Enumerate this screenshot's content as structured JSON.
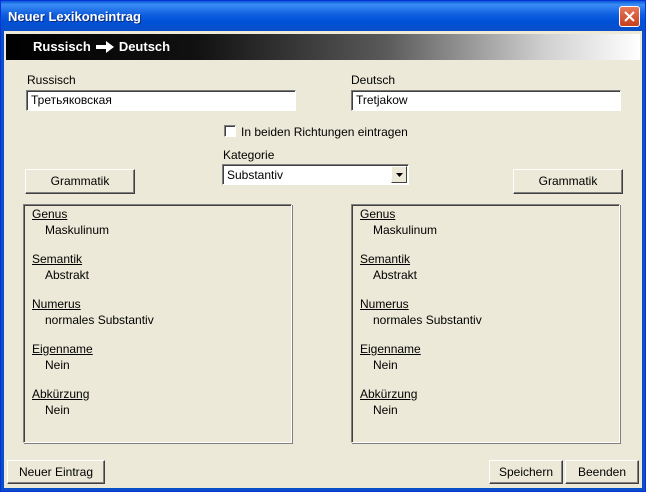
{
  "window": {
    "title": "Neuer Lexikoneintrag"
  },
  "banner": {
    "source": "Russisch",
    "target": "Deutsch"
  },
  "left": {
    "label": "Russisch",
    "value": "Третьяковская"
  },
  "right": {
    "label": "Deutsch",
    "value": "Tretjakow"
  },
  "options": {
    "both_directions_label": "In beiden Richtungen eintragen",
    "both_directions_checked": false
  },
  "category": {
    "label": "Kategorie",
    "selected": "Substantiv"
  },
  "buttons": {
    "grammar_left": "Grammatik",
    "grammar_right": "Grammatik",
    "new_entry": "Neuer Eintrag",
    "save": "Speichern",
    "quit": "Beenden"
  },
  "grammar_left": [
    {
      "title": "Genus",
      "value": "Maskulinum"
    },
    {
      "title": "Semantik",
      "value": "Abstrakt"
    },
    {
      "title": "Numerus",
      "value": "normales Substantiv"
    },
    {
      "title": "Eigenname",
      "value": "Nein"
    },
    {
      "title": "Abkürzung",
      "value": "Nein"
    }
  ],
  "grammar_right": [
    {
      "title": "Genus",
      "value": "Maskulinum"
    },
    {
      "title": "Semantik",
      "value": "Abstrakt"
    },
    {
      "title": "Numerus",
      "value": "normales Substantiv"
    },
    {
      "title": "Eigenname",
      "value": "Nein"
    },
    {
      "title": "Abkürzung",
      "value": "Nein"
    }
  ]
}
